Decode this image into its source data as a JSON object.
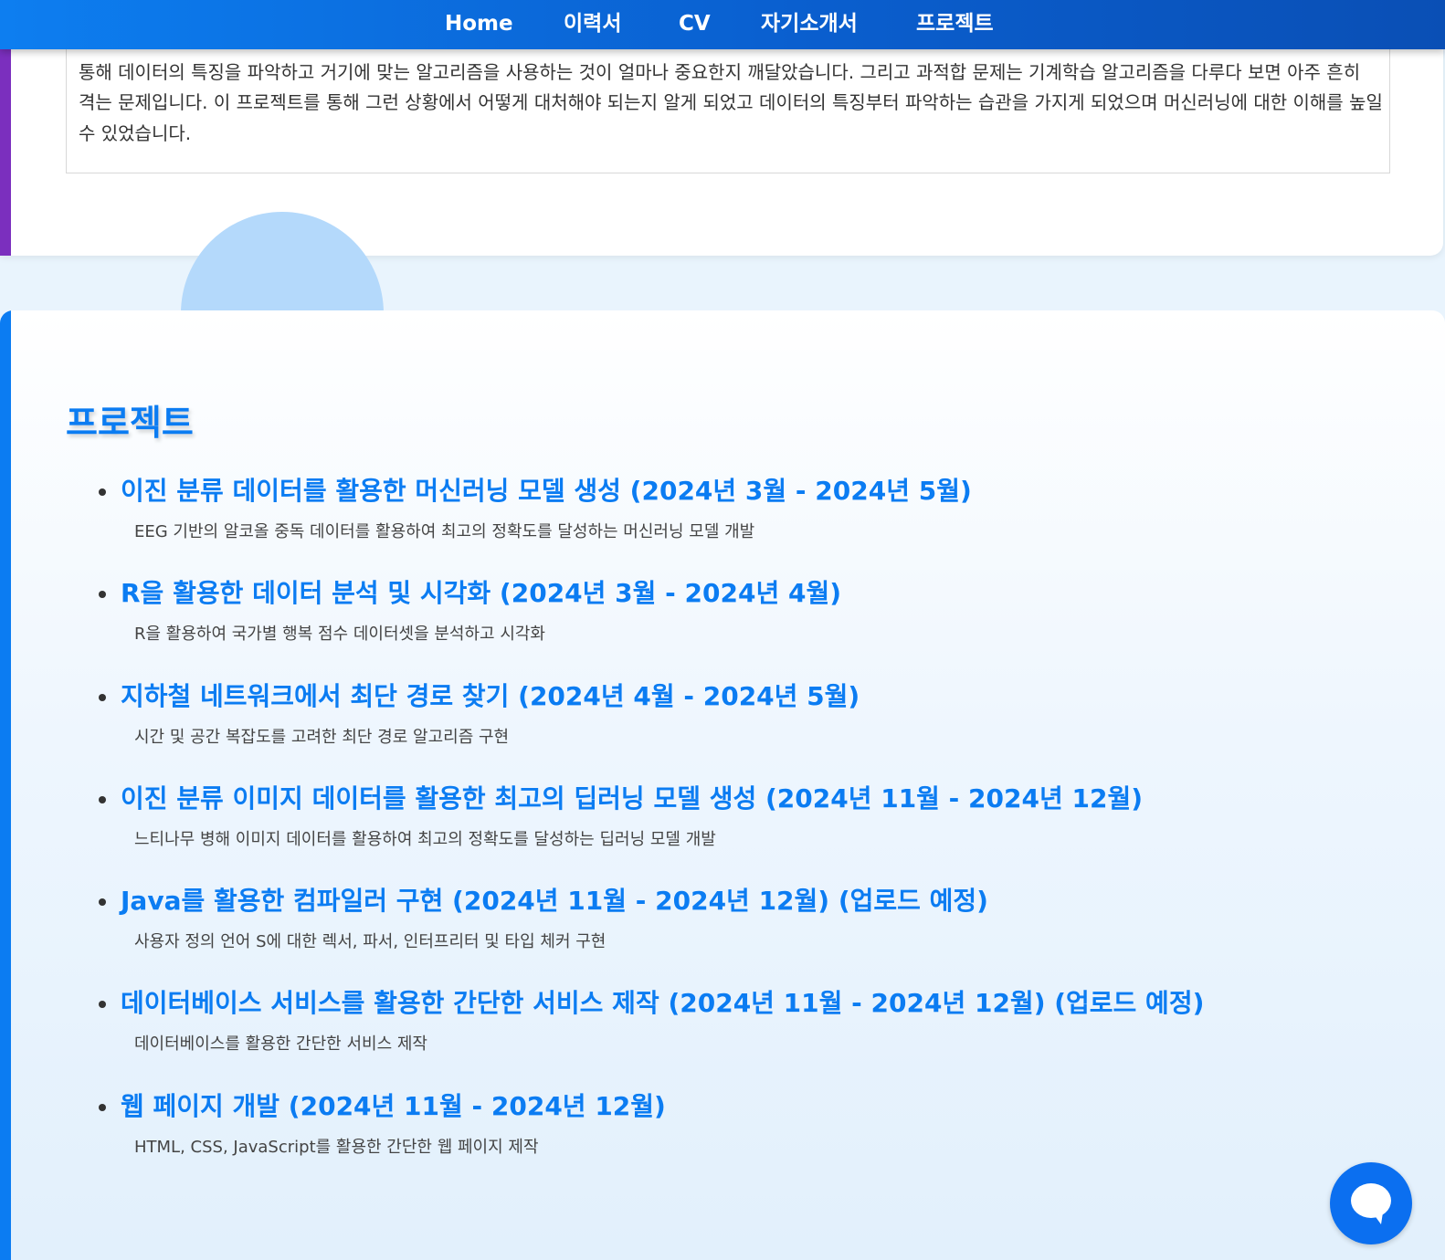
{
  "nav": {
    "items": [
      {
        "label": "Home"
      },
      {
        "label": "이력서"
      },
      {
        "label": "CV"
      },
      {
        "label": "자기소개서"
      },
      {
        "label": "프로젝트"
      }
    ]
  },
  "reflection": {
    "text": "처음 데이터가 어떤 특징을 가지는지 확인도 하지 않은 채 무작정 로지스틱회귀를 사용하여 분류하려다 보니 이 과정에서 굉장히 많은 시간을 보냈습니다. 그러나 이과정을 통해 데이터의 특징을 파악하고 거기에 맞는 알고리즘을 사용하는 것이 얼마나 중요한지 깨달았습니다. 그리고 과적합 문제는 기계학습 알고리즘을 다루다 보면 아주 흔히 격는 문제입니다. 이 프로젝트를 통해 그런 상황에서 어떻게 대처해야 되는지 알게 되었고 데이터의 특징부터 파악하는 습관을 가지게 되었으며 머신러닝에 대한 이해를 높일 수 있었습니다."
  },
  "projects": {
    "heading": "프로젝트",
    "items": [
      {
        "title": "이진 분류 데이터를 활용한 머신러닝 모델 생성 (2024년 3월 - 2024년 5월)",
        "desc": "EEG 기반의 알코올 중독 데이터를 활용하여 최고의 정확도를 달성하는 머신러닝 모델 개발"
      },
      {
        "title": "R을 활용한 데이터 분석 및 시각화 (2024년 3월 - 2024년 4월)",
        "desc": "R을 활용하여 국가별 행복 점수 데이터셋을 분석하고 시각화"
      },
      {
        "title": "지하철 네트워크에서 최단 경로 찾기 (2024년 4월 - 2024년 5월)",
        "desc": "시간 및 공간 복잡도를 고려한 최단 경로 알고리즘 구현"
      },
      {
        "title": "이진 분류 이미지 데이터를 활용한 최고의 딥러닝 모델 생성 (2024년 11월 - 2024년 12월)",
        "desc": "느티나무 병해 이미지 데이터를 활용하여 최고의 정확도를 달성하는 딥러닝 모델 개발"
      },
      {
        "title": "Java를 활용한 컴파일러 구현 (2024년 11월 - 2024년 12월) (업로드 예정)",
        "desc": "사용자 정의 언어 S에 대한 렉서, 파서, 인터프리터 및 타입 체커 구현"
      },
      {
        "title": "데이터베이스 서비스를 활용한 간단한 서비스 제작 (2024년 11월 - 2024년 12월) (업로드 예정)",
        "desc": "데이터베이스를 활용한 간단한 서비스 제작"
      },
      {
        "title": "웹 페이지 개발 (2024년 11월 - 2024년 12월)",
        "desc": "HTML, CSS, JavaScript를 활용한 간단한 웹 페이지 제작"
      }
    ]
  },
  "chat": {
    "icon": "chat-bubble-icon"
  },
  "colors": {
    "nav_start": "#0d7ef0",
    "nav_end": "#0a4fb5",
    "accent_blue": "#0b7cf2",
    "accent_purple": "#7b2fbe",
    "page_bg": "#e9f4fd",
    "deco_circle": "#b4d9fb"
  }
}
